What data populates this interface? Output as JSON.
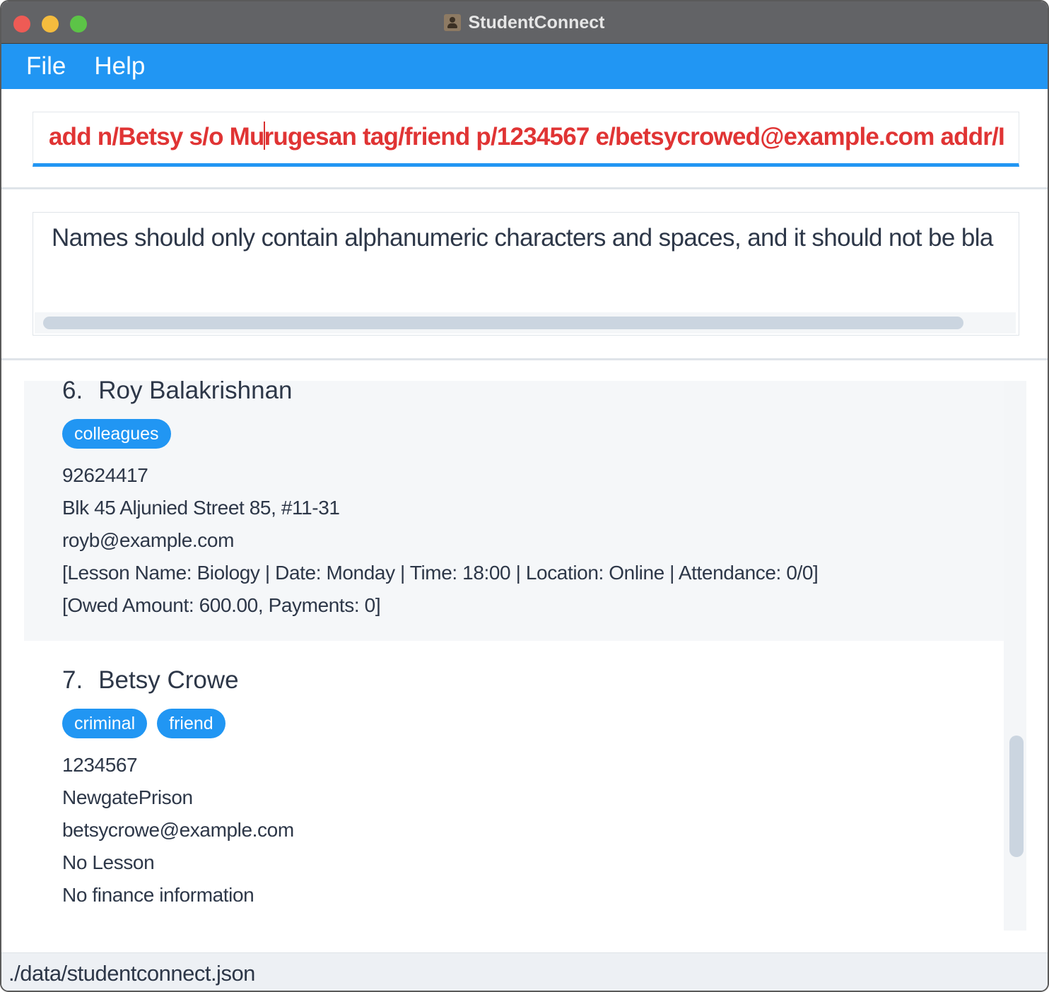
{
  "window": {
    "title": "StudentConnect",
    "app_icon": "person-card-icon"
  },
  "menu": {
    "items": [
      "File",
      "Help"
    ]
  },
  "command": {
    "value": "add n/Betsy s/o Murugesan tag/friend p/1234567 e/betsycrowed@example.com addr/I",
    "text_before_caret": "add n/Betsy s/o Mu",
    "text_after_caret": "rugesan tag/friend p/1234567 e/betsycrowed@example.com addr/I",
    "error_color": "#e03434"
  },
  "result": {
    "message": "Names should only contain alphanumeric characters and spaces, and it should not be bla"
  },
  "persons": [
    {
      "index": "6.",
      "name": "Roy Balakrishnan",
      "tags": [
        "colleagues"
      ],
      "phone": "92624417",
      "address": "Blk 45 Aljunied Street 85, #11-31",
      "email": "royb@example.com",
      "lesson": "[Lesson Name: Biology | Date: Monday | Time: 18:00 | Location: Online | Attendance: 0/0]",
      "finance": "[Owed Amount: 600.00, Payments: 0]"
    },
    {
      "index": "7.",
      "name": "Betsy Crowe",
      "tags": [
        "criminal",
        "friend"
      ],
      "phone": "1234567",
      "address": "NewgatePrison",
      "email": "betsycrowe@example.com",
      "lesson": "No Lesson",
      "finance": "No finance information"
    }
  ],
  "status": {
    "file_path": "./data/studentconnect.json"
  },
  "colors": {
    "accent": "#2196f3",
    "titlebar": "#626366",
    "text": "#2d3748"
  }
}
